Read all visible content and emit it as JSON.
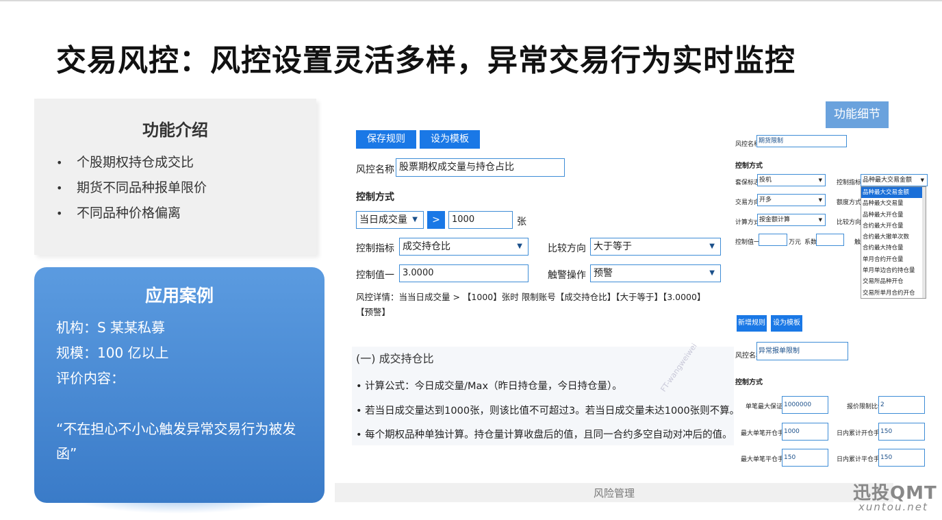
{
  "page_title": "交易风控：风控设置灵活多样，异常交易行为实时监控",
  "intro": {
    "heading": "功能介绍",
    "bullet": "•",
    "items": [
      "个股期权持仓成交比",
      "期货不同品种报单限价",
      "不同品种价格偏离"
    ]
  },
  "case": {
    "heading": "应用案例",
    "org": "机构：S 某某私募",
    "scale": "规模：100 亿以上",
    "review_label": "评价内容：",
    "quote": "“不在担心不小心触发异常交易行为被发函”"
  },
  "main": {
    "save_rule": "保存规则",
    "set_template": "设为模板",
    "rule_name_label": "风控名称",
    "rule_name_value": "股票期权成交量与持仓占比",
    "control_mode_label": "控制方式",
    "condition_select": "当日成交量",
    "arrow": ">",
    "threshold_value": "1000",
    "unit": "张",
    "indicator_label": "控制指标",
    "indicator_value": "成交持仓比",
    "compare_label": "比较方向",
    "compare_value": "大于等于",
    "control_value_label": "控制值一",
    "control_value": "3.0000",
    "alarm_label": "触警操作",
    "alarm_value": "预警",
    "detail_text": "风控详情：当当日成交量 > 【1000】张时 限制账号【成交持仓比】【大于等于】【3.0000】【预警】",
    "formula_heading": "(一) 成交持仓比",
    "formula_lines": [
      "•  计算公式：今日成交量/Max（昨日持仓量，今日持仓量）。",
      "•  若当日成交量达到1000张，则该比值不可超过3。若当日成交量未达1000张则不算。",
      "•  每个期权品种单独计算。持仓量计算收盘后的值，且同一合约多空自动对冲后的值。"
    ],
    "watermark": "FT-wangweiwei",
    "footer": "风险管理"
  },
  "details": {
    "button": "功能细节",
    "top": {
      "name_label": "风控名称",
      "name_value": "期货限制",
      "mode_label": "控制方式",
      "hedge_label": "套保标志",
      "hedge_value": "投机",
      "indicator_label": "控制指标",
      "indicator_value": "品种最大交易金额",
      "direction_label": "交易方向",
      "direction_value": "开多",
      "quota_label": "额度方式",
      "calc_label": "计算方式",
      "calc_value": "按金额计算",
      "compare_label": "比较方向",
      "value_label": "控制值一",
      "unit": "万元",
      "coef_label": "系数",
      "trigger_label": "触",
      "options": [
        "品种最大交易金额",
        "品种最大交易量",
        "品种最大开仓量",
        "合约最大开仓量",
        "合约最大撤单次数",
        "合约最大持仓量",
        "单月合约开仓量",
        "单月单边合约持仓量",
        "交易所品种开仓",
        "交易所单月合约开仓"
      ]
    },
    "bottom": {
      "new_rule": "新增规则",
      "set_template": "设为模板",
      "name_label": "风控名称",
      "name_value": "异常报单限制",
      "mode_label": "控制方式",
      "rows": [
        {
          "l1": "单笔最大保证金",
          "v1": "1000000",
          "l2": "报价限制比例",
          "v2": "2"
        },
        {
          "l1": "最大单笔开仓手数",
          "v1": "1000",
          "l2": "日内累计开仓手数",
          "v2": "150"
        },
        {
          "l1": "最大单笔平仓手数",
          "v1": "150",
          "l2": "日内累计平仓手数",
          "v2": "150"
        }
      ]
    }
  },
  "logo": {
    "main": "迅投QMT",
    "sub": "xuntou.net"
  },
  "colors": {
    "accent": "#1a78e6",
    "case_bg": "#4a8bd6",
    "detail_btn": "#6aa2dd"
  }
}
